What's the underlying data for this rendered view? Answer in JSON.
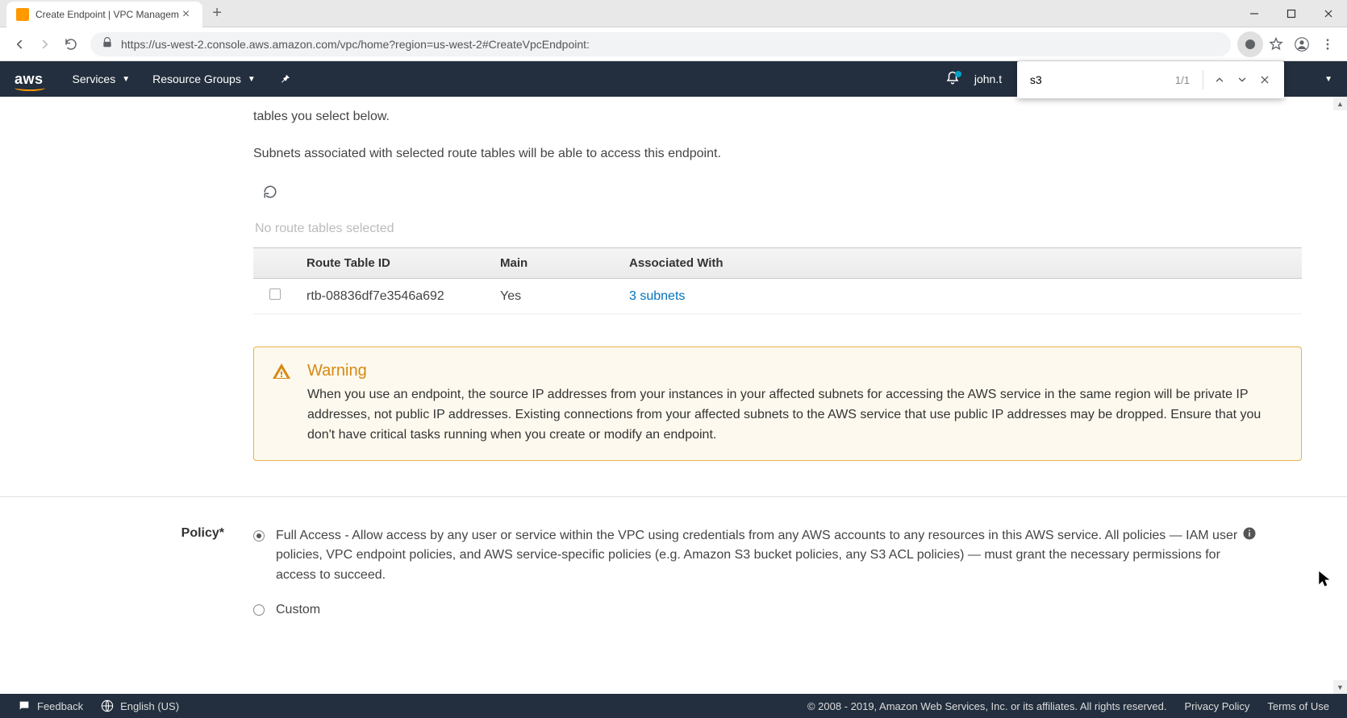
{
  "browser": {
    "tab_title": "Create Endpoint | VPC Managem",
    "url": "https://us-west-2.console.aws.amazon.com/vpc/home?region=us-west-2#CreateVpcEndpoint:"
  },
  "find_bar": {
    "query": "s3",
    "matches": "1/1"
  },
  "aws_header": {
    "services": "Services",
    "resource_groups": "Resource Groups",
    "user": "john.t"
  },
  "content": {
    "intro_line1": "tables you select below.",
    "intro_line2": "Subnets associated with selected route tables will be able to access this endpoint.",
    "no_selection": "No route tables selected",
    "table": {
      "headers": [
        "",
        "Route Table ID",
        "Main",
        "Associated With",
        ""
      ],
      "rows": [
        {
          "checked": false,
          "route_table_id": "rtb-08836df7e3546a692",
          "main": "Yes",
          "associated_with": "3 subnets"
        }
      ]
    },
    "warning": {
      "title": "Warning",
      "body": "When you use an endpoint, the source IP addresses from your instances in your affected subnets for accessing the AWS service in the same region will be private IP addresses, not public IP addresses. Existing connections from your affected subnets to the AWS service that use public IP addresses may be dropped. Ensure that you don't have critical tasks running when you create or modify an endpoint."
    },
    "policy": {
      "label": "Policy*",
      "full_access": "Full Access - Allow access by any user or service within the VPC using credentials from any AWS accounts to any resources in this AWS service. All policies — IAM user policies, VPC endpoint policies, and AWS service-specific policies (e.g. Amazon S3 bucket policies, any S3 ACL policies) — must grant the necessary permissions for access to succeed.",
      "custom": "Custom"
    }
  },
  "footer": {
    "feedback": "Feedback",
    "language": "English (US)",
    "copyright": "© 2008 - 2019, Amazon Web Services, Inc. or its affiliates. All rights reserved.",
    "privacy": "Privacy Policy",
    "terms": "Terms of Use"
  }
}
